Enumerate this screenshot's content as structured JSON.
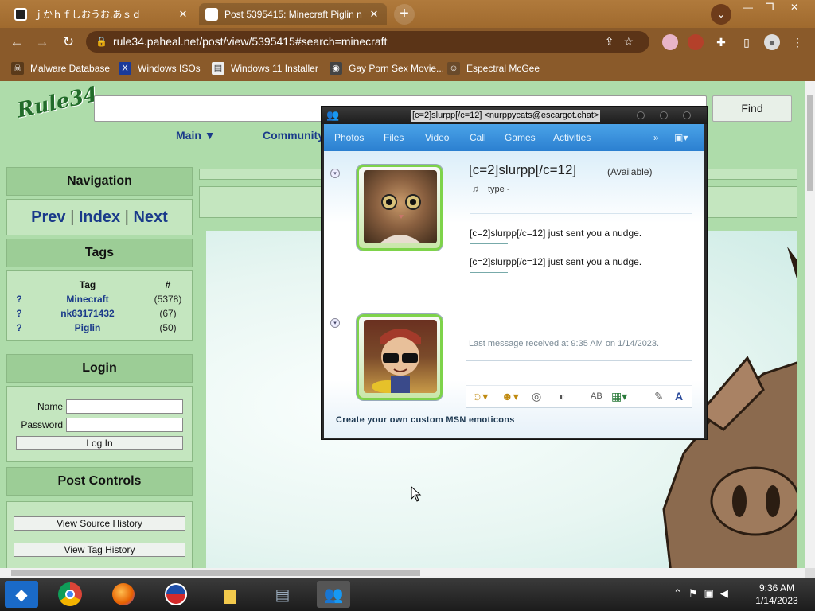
{
  "browser": {
    "tabs": [
      {
        "title": "ｊかｈｆしおうお.あｓｄ",
        "close": "✕"
      },
      {
        "title": "Post 5395415: Minecraft Piglin n",
        "close": "✕"
      }
    ],
    "new_tab": "+",
    "url": "rule34.paheal.net/post/view/5395415#search=minecraft",
    "bookmarks": [
      {
        "label": "Malware Database",
        "icon": "skull-icon"
      },
      {
        "label": "Windows ISOs",
        "icon": "x-icon"
      },
      {
        "label": "Windows 11 Installer",
        "icon": "page-icon"
      },
      {
        "label": "Gay Porn Sex Movie...",
        "icon": "site-icon"
      },
      {
        "label": "Espectral McGee",
        "icon": "avatar-icon"
      }
    ]
  },
  "site": {
    "logo": "Rule34",
    "find_label": "Find",
    "main_menu": "Main ▼",
    "community_menu": "Community",
    "navigation_header": "Navigation",
    "prev": "Prev",
    "index": "Index",
    "next": "Next",
    "sep": "|",
    "tags_header": "Tags",
    "tag_col": "Tag",
    "count_col": "#",
    "tags": [
      {
        "q": "?",
        "name": "Minecraft",
        "count": "(5378)"
      },
      {
        "q": "?",
        "name": "nk63171432",
        "count": "(67)"
      },
      {
        "q": "?",
        "name": "Piglin",
        "count": "(50)"
      }
    ],
    "login_header": "Login",
    "name_label": "Name",
    "password_label": "Password",
    "login_button": "Log In",
    "post_controls_header": "Post Controls",
    "view_source_history": "View Source History",
    "view_tag_history": "View Tag History"
  },
  "msn": {
    "title": "[c=2]slurpp[/c=12] <nurppycats@escargot.chat>",
    "menu": [
      "Photos",
      "Files",
      "Video",
      "Call",
      "Games",
      "Activities"
    ],
    "more": "»",
    "contact_name": "[c=2]slurpp[/c=12]",
    "contact_status": "(Available)",
    "psm": "type -",
    "messages": [
      "[c=2]slurpp[/c=12] just sent you a nudge.",
      "[c=2]slurpp[/c=12] just sent you a nudge."
    ],
    "last_message": "Last message received at 9:35 AM on 1/14/2023.",
    "ad_text": "Create your own custom MSN emoticons"
  },
  "taskbar": {
    "time": "9:36 AM",
    "date": "1/14/2023"
  }
}
